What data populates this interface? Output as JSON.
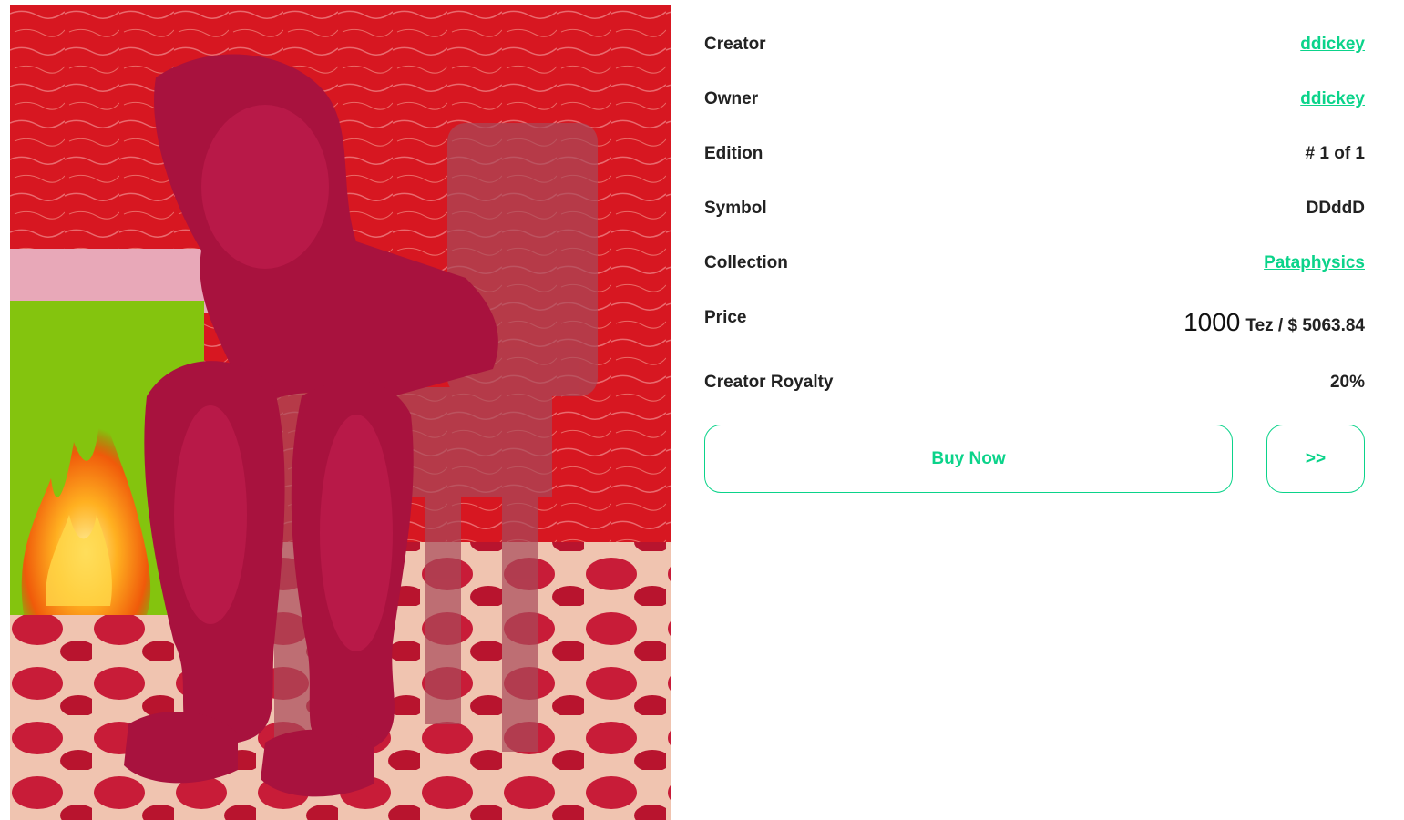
{
  "artwork": {
    "subject": "nft-artwork"
  },
  "details": {
    "creator": {
      "label": "Creator",
      "value": "ddickey"
    },
    "owner": {
      "label": "Owner",
      "value": "ddickey"
    },
    "edition": {
      "label": "Edition",
      "value": "# 1 of 1"
    },
    "symbol": {
      "label": "Symbol",
      "value": "DDddD"
    },
    "collection": {
      "label": "Collection",
      "value": "Pataphysics"
    },
    "price": {
      "label": "Price",
      "amount": "1000",
      "rest": "Tez / $ 5063.84"
    },
    "royalty": {
      "label": "Creator Royalty",
      "value": "20%"
    }
  },
  "actions": {
    "buy_label": "Buy Now",
    "more_label": ">>"
  },
  "colors": {
    "accent": "#0bd38a",
    "text": "#222222",
    "background": "#ffffff"
  }
}
